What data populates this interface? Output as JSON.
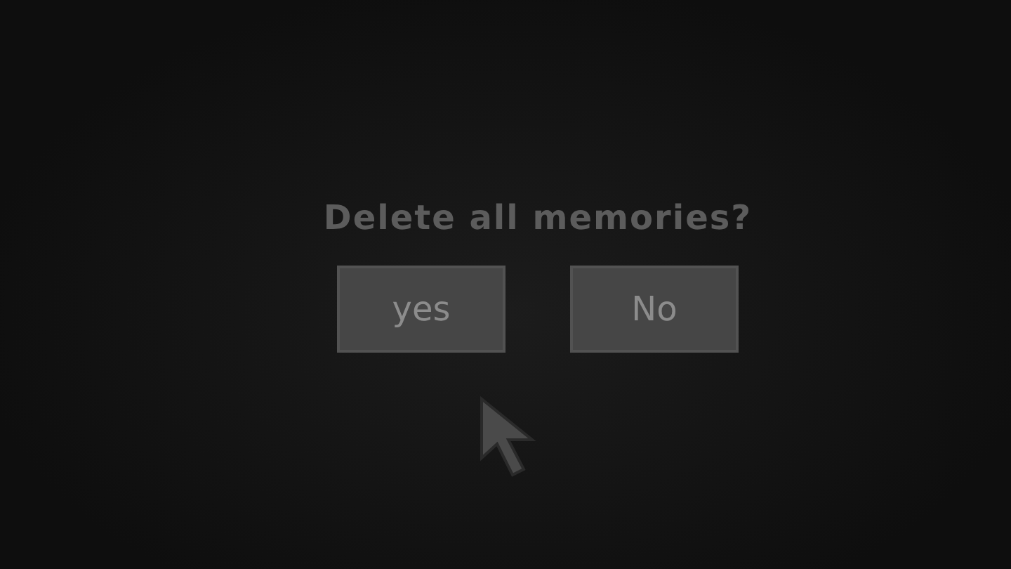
{
  "dialog": {
    "message": "Delete all memories?",
    "buttons": [
      {
        "label": "yes"
      },
      {
        "label": "No"
      }
    ]
  }
}
